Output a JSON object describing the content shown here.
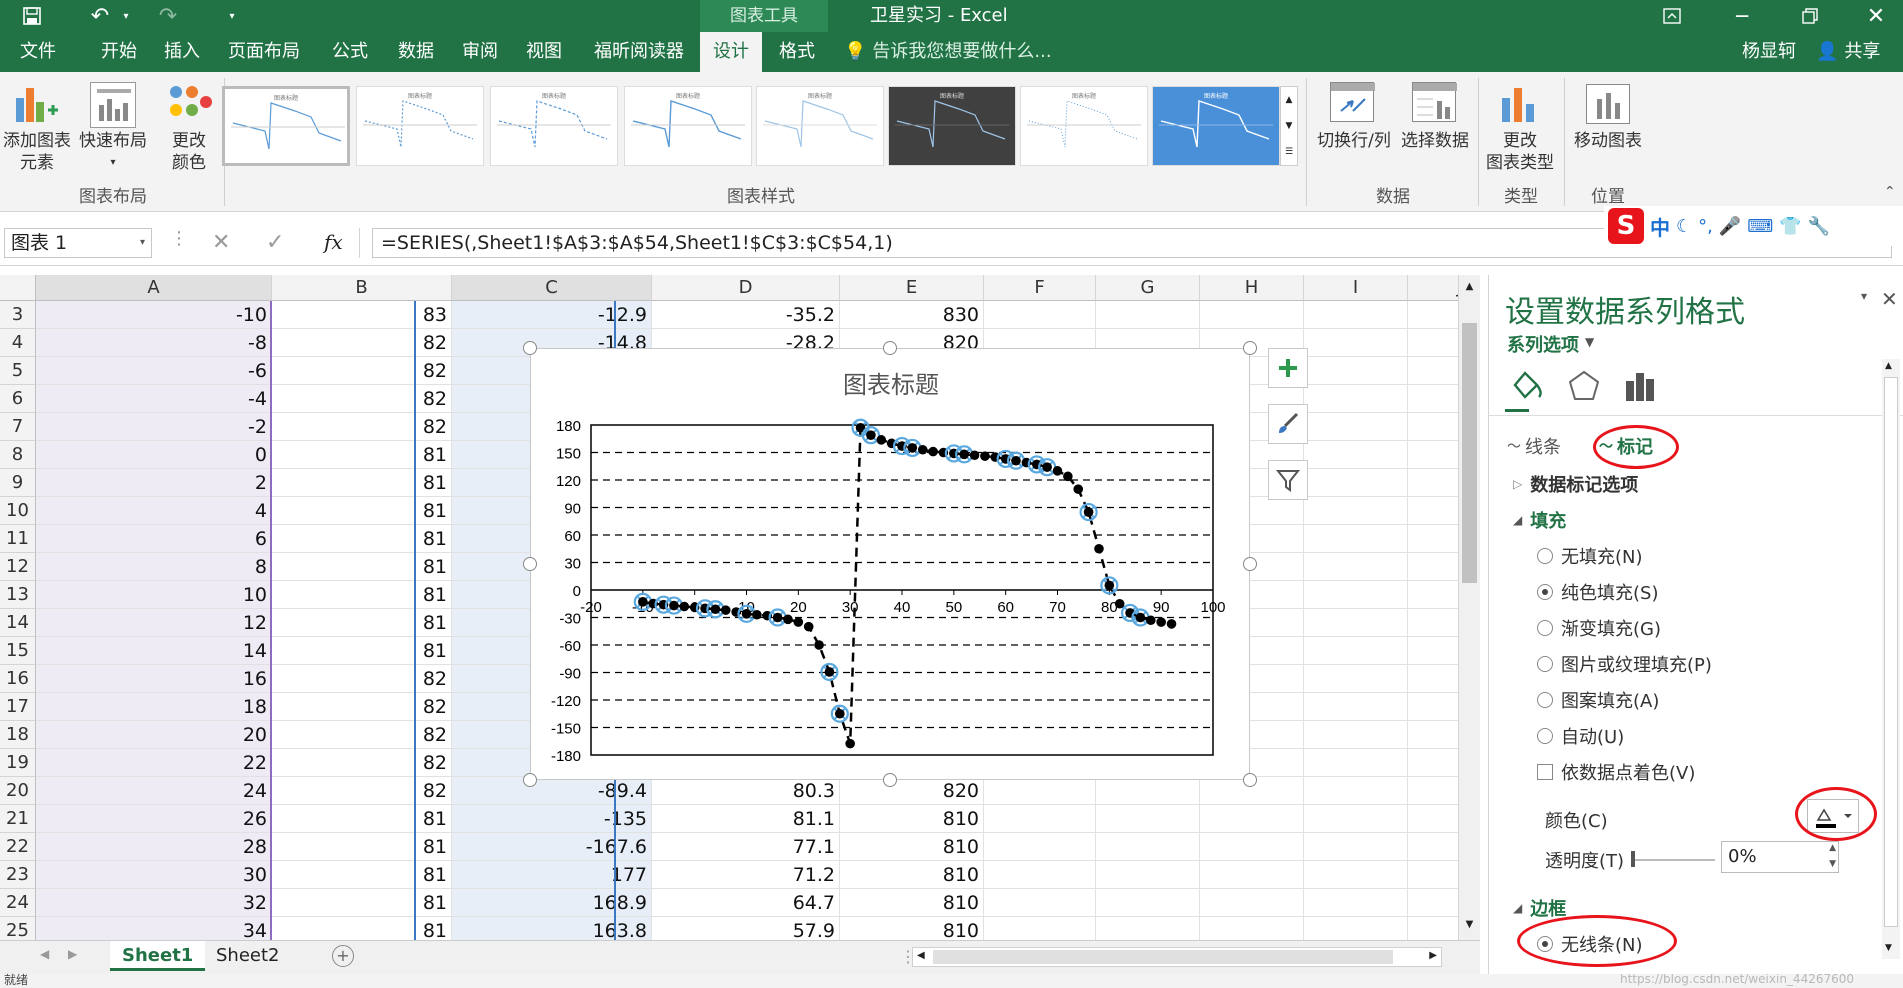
{
  "titlebar": {
    "title": "卫星实习 - Excel",
    "context_tab": "图表工具"
  },
  "tabs": [
    "文件",
    "开始",
    "插入",
    "页面布局",
    "公式",
    "数据",
    "审阅",
    "视图",
    "福昕阅读器",
    "设计",
    "格式"
  ],
  "tell_me": "告诉我您想要做什么...",
  "user": {
    "name": "杨显轲",
    "share": "共享"
  },
  "ribbon": {
    "add_element": "添加图表\n元素",
    "quick_layout": "快速布局",
    "change_color": "更改\n颜色",
    "group_layout": "图表布局",
    "group_styles": "图表样式",
    "switch_rowcol": "切换行/列",
    "select_data": "选择数据",
    "group_data": "数据",
    "change_type": "更改\n图表类型",
    "group_type": "类型",
    "move_chart": "移动图表",
    "group_position": "位置",
    "thumb_title": "图表标题"
  },
  "formula": {
    "namebox": "图表 1",
    "fx": "fx",
    "content": "=SERIES(,Sheet1!$A$3:$A$54,Sheet1!$C$3:$C$54,1)"
  },
  "ime": {
    "label": "中"
  },
  "columns": [
    "A",
    "B",
    "C",
    "D",
    "E",
    "F",
    "G",
    "H",
    "I",
    "J"
  ],
  "rows": [
    {
      "n": "3",
      "a": "-10",
      "b": "83",
      "c": "-12.9",
      "d": "-35.2",
      "e": "830"
    },
    {
      "n": "4",
      "a": "-8",
      "b": "82",
      "c": "-14.8",
      "d": "-28.2",
      "e": "820"
    },
    {
      "n": "5",
      "a": "-6",
      "b": "82",
      "c": "",
      "d": "",
      "e": ""
    },
    {
      "n": "6",
      "a": "-4",
      "b": "82",
      "c": "",
      "d": "",
      "e": ""
    },
    {
      "n": "7",
      "a": "-2",
      "b": "82",
      "c": "",
      "d": "",
      "e": ""
    },
    {
      "n": "8",
      "a": "0",
      "b": "81",
      "c": "",
      "d": "",
      "e": ""
    },
    {
      "n": "9",
      "a": "2",
      "b": "81",
      "c": "",
      "d": "",
      "e": ""
    },
    {
      "n": "10",
      "a": "4",
      "b": "81",
      "c": "",
      "d": "",
      "e": ""
    },
    {
      "n": "11",
      "a": "6",
      "b": "81",
      "c": "",
      "d": "",
      "e": ""
    },
    {
      "n": "12",
      "a": "8",
      "b": "81",
      "c": "",
      "d": "",
      "e": ""
    },
    {
      "n": "13",
      "a": "10",
      "b": "81",
      "c": "",
      "d": "",
      "e": ""
    },
    {
      "n": "14",
      "a": "12",
      "b": "81",
      "c": "",
      "d": "",
      "e": ""
    },
    {
      "n": "15",
      "a": "14",
      "b": "81",
      "c": "",
      "d": "",
      "e": ""
    },
    {
      "n": "16",
      "a": "16",
      "b": "82",
      "c": "",
      "d": "",
      "e": ""
    },
    {
      "n": "17",
      "a": "18",
      "b": "82",
      "c": "",
      "d": "",
      "e": ""
    },
    {
      "n": "18",
      "a": "20",
      "b": "82",
      "c": "",
      "d": "",
      "e": ""
    },
    {
      "n": "19",
      "a": "22",
      "b": "82",
      "c": "",
      "d": "",
      "e": ""
    },
    {
      "n": "20",
      "a": "24",
      "b": "82",
      "c": "-89.4",
      "d": "80.3",
      "e": "820"
    },
    {
      "n": "21",
      "a": "26",
      "b": "81",
      "c": "-135",
      "d": "81.1",
      "e": "810"
    },
    {
      "n": "22",
      "a": "28",
      "b": "81",
      "c": "-167.6",
      "d": "77.1",
      "e": "810"
    },
    {
      "n": "23",
      "a": "30",
      "b": "81",
      "c": "177",
      "d": "71.2",
      "e": "810"
    },
    {
      "n": "24",
      "a": "32",
      "b": "81",
      "c": "168.9",
      "d": "64.7",
      "e": "810"
    },
    {
      "n": "25",
      "a": "34",
      "b": "81",
      "c": "163.8",
      "d": "57.9",
      "e": "810"
    }
  ],
  "sheets": {
    "tabs": [
      "Sheet1",
      "Sheet2"
    ],
    "active": "Sheet1"
  },
  "status": {
    "left": "就绪",
    "watermark": "https://blog.csdn.net/weixin_44267600"
  },
  "pane": {
    "title": "设置数据系列格式",
    "series_options": "系列选项",
    "tab_line": "线条",
    "tab_marker": "标记",
    "marker_options": "数据标记选项",
    "fill_header": "填充",
    "fill_options": [
      "无填充(N)",
      "纯色填充(S)",
      "渐变填充(G)",
      "图片或纹理填充(P)",
      "图案填充(A)",
      "自动(U)"
    ],
    "selected_fill": "纯色填充(S)",
    "vary_colors": "依数据点着色(V)",
    "color_label": "颜色(C)",
    "transparency_label": "透明度(T)",
    "transparency_value": "0%",
    "border_header": "边框",
    "no_line": "无线条(N)"
  },
  "colors": {
    "excel_green": "#217346",
    "highlight_red": "#e8141b",
    "marker_blue": "#5aa8e0"
  },
  "chart_data": {
    "type": "scatter",
    "title": "图表标题",
    "xlim": [
      -20,
      100
    ],
    "ylim": [
      -180,
      180
    ],
    "xticks": [
      "-20",
      "-10",
      "0",
      "10",
      "20",
      "30",
      "40",
      "50",
      "60",
      "70",
      "80",
      "90",
      "100"
    ],
    "yticks": [
      "180",
      "150",
      "120",
      "90",
      "60",
      "30",
      "0",
      "-30",
      "-60",
      "-90",
      "-120",
      "-150",
      "-180"
    ],
    "grid": "dashed horizontal",
    "line_style": "dashed",
    "x": [
      -10,
      -8,
      -6,
      -4,
      -2,
      0,
      2,
      4,
      6,
      8,
      10,
      12,
      14,
      16,
      18,
      20,
      22,
      24,
      26,
      28,
      30,
      32,
      34,
      36,
      38,
      40,
      42,
      44,
      46,
      48,
      50,
      52,
      54,
      56,
      58,
      60,
      62,
      64,
      66,
      68,
      70,
      72,
      74,
      76,
      78,
      80,
      82,
      84,
      86,
      88,
      90,
      92
    ],
    "y": [
      -12.9,
      -14.8,
      -16,
      -17,
      -18,
      -19,
      -20,
      -21,
      -22,
      -24,
      -26,
      -27,
      -28,
      -30,
      -32,
      -35,
      -40,
      -60,
      -89.4,
      -135,
      -167.6,
      177,
      168.9,
      163.8,
      160,
      157,
      155,
      153,
      151,
      150,
      149,
      148,
      147,
      146,
      145,
      143,
      141,
      139,
      137,
      134,
      130,
      124,
      110,
      85,
      45,
      5,
      -15,
      -25,
      -30,
      -33,
      -35,
      -37
    ],
    "marked_x": [
      -10,
      -6,
      -4,
      2,
      4,
      10,
      16,
      26,
      28,
      32,
      34,
      40,
      42,
      50,
      52,
      60,
      62,
      66,
      68,
      76,
      80,
      84,
      86
    ]
  }
}
